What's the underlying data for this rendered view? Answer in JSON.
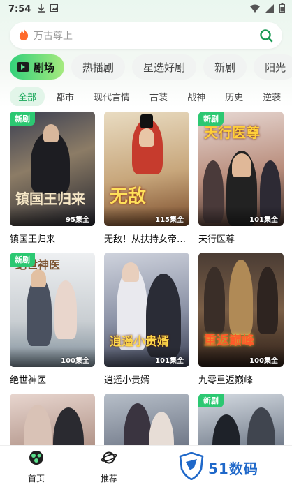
{
  "status_bar": {
    "time": "7:54"
  },
  "search": {
    "placeholder": "万古尊上"
  },
  "main_tabs": [
    {
      "label": "剧场"
    },
    {
      "label": "热播剧"
    },
    {
      "label": "星选好剧"
    },
    {
      "label": "新剧"
    },
    {
      "label": "阳光"
    }
  ],
  "sub_tabs": [
    {
      "label": "全部"
    },
    {
      "label": "都市"
    },
    {
      "label": "现代言情"
    },
    {
      "label": "古装"
    },
    {
      "label": "战神"
    },
    {
      "label": "历史"
    },
    {
      "label": "逆袭"
    }
  ],
  "dramas": [
    {
      "title": "镇国王归来",
      "episodes": "95集全",
      "badge": "新剧",
      "poster_text": "镇国王归来"
    },
    {
      "title": "无敌！从扶持女帝开始",
      "episodes": "115集全",
      "badge": "",
      "poster_text": "无敌"
    },
    {
      "title": "天行医尊",
      "episodes": "101集全",
      "badge": "新剧",
      "poster_text": "天行医尊"
    },
    {
      "title": "绝世神医",
      "episodes": "100集全",
      "badge": "新剧",
      "poster_text": "绝世神医"
    },
    {
      "title": "逍遥小贵婿",
      "episodes": "101集全",
      "badge": "",
      "poster_text": "逍遥小贵婿"
    },
    {
      "title": "九零重返巅峰",
      "episodes": "100集全",
      "badge": "",
      "poster_text": "重返巅峰"
    },
    {
      "title": "",
      "episodes": "",
      "badge": "",
      "poster_text": ""
    },
    {
      "title": "",
      "episodes": "",
      "badge": "",
      "poster_text": ""
    },
    {
      "title": "",
      "episodes": "",
      "badge": "新剧",
      "poster_text": ""
    }
  ],
  "bottom_nav": [
    {
      "label": "首页",
      "icon": "home-icon"
    },
    {
      "label": "推荐",
      "icon": "planet-icon"
    }
  ],
  "watermark": {
    "text": "51数码"
  },
  "colors": {
    "accent": "#2cc872",
    "tab_gradient_start": "#32d07a",
    "tab_gradient_end": "#a6ea7e",
    "watermark": "#1f68c9"
  }
}
